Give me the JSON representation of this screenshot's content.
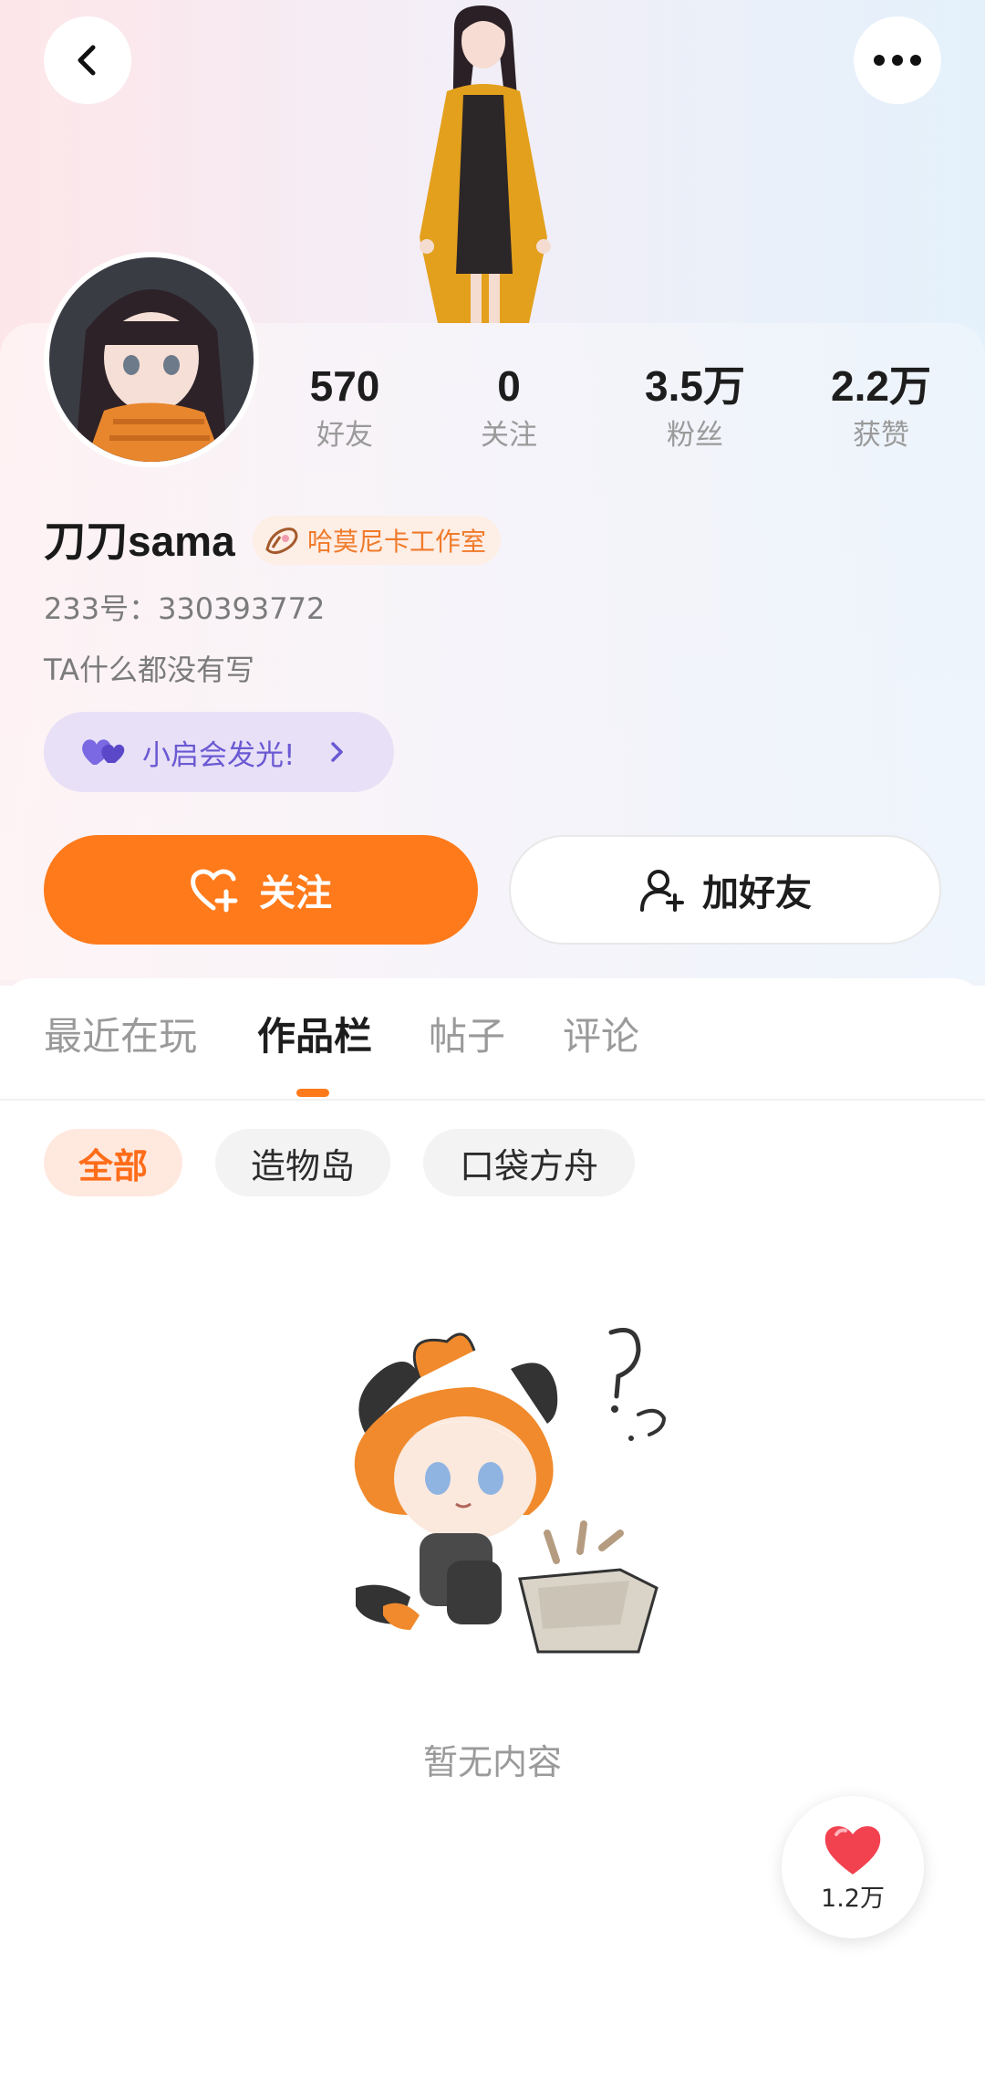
{
  "header": {
    "back_icon": "chevron-left-icon",
    "more_icon": "more-dots-icon"
  },
  "profile": {
    "stats": [
      {
        "value": "570",
        "label": "好友"
      },
      {
        "value": "0",
        "label": "关注"
      },
      {
        "value": "3.5万",
        "label": "粉丝"
      },
      {
        "value": "2.2万",
        "label": "获赞"
      }
    ],
    "username": "刀刀sama",
    "studio_badge": "哈莫尼卡工作室",
    "uid": "233号：330393772",
    "bio": "TA什么都没有写",
    "glow_pill": "小启会发光!"
  },
  "actions": {
    "follow": "关注",
    "add_friend": "加好友"
  },
  "tabs": [
    {
      "label": "最近在玩",
      "active": false
    },
    {
      "label": "作品栏",
      "active": true
    },
    {
      "label": "帖子",
      "active": false
    },
    {
      "label": "评论",
      "active": false
    }
  ],
  "filters": [
    {
      "label": "全部",
      "active": true
    },
    {
      "label": "造物岛",
      "active": false
    },
    {
      "label": "口袋方舟",
      "active": false
    }
  ],
  "empty_state": {
    "text": "暂无内容"
  },
  "like_float": {
    "count": "1.2万"
  },
  "colors": {
    "accent": "#ff7a1b",
    "studio": "#f07a29",
    "glow": "#6a59d2"
  }
}
